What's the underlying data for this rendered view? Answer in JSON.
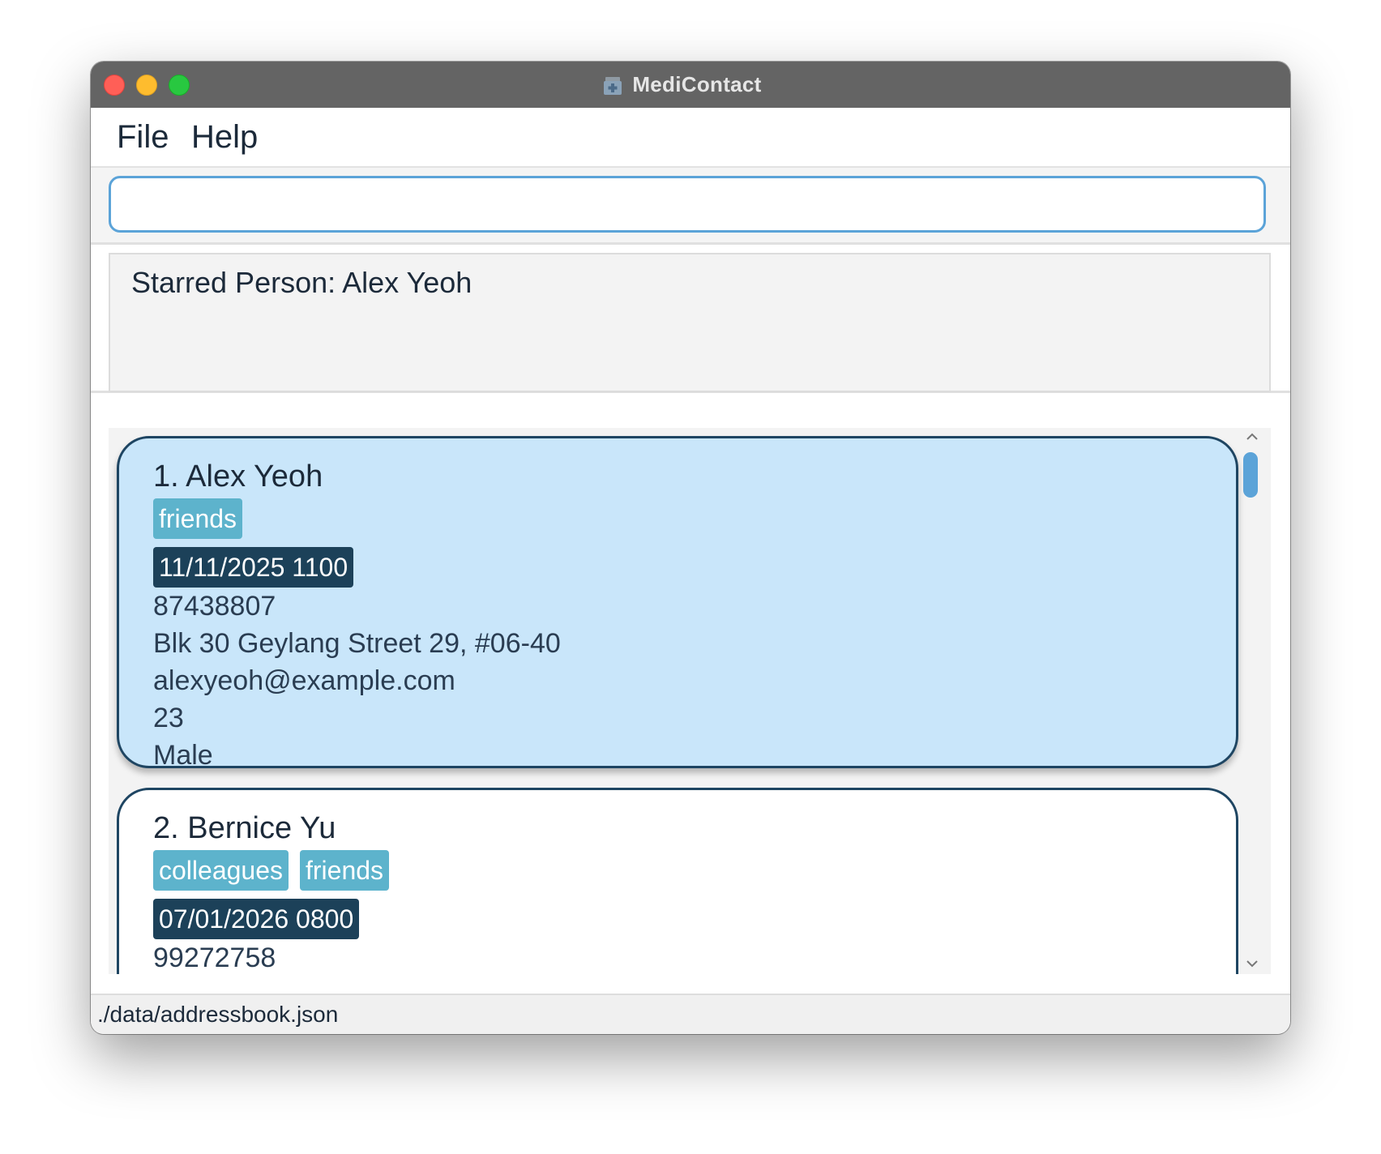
{
  "window": {
    "title": "MediContact",
    "app_icon": "medical-kit-icon"
  },
  "menu": {
    "file_label": "File",
    "help_label": "Help"
  },
  "command": {
    "value": "",
    "placeholder": ""
  },
  "result": {
    "text": "Starred Person: Alex Yeoh"
  },
  "persons": [
    {
      "name": "1. Alex Yeoh",
      "tags": [
        "friends"
      ],
      "appointment": "11/11/2025 1100",
      "phone": "87438807",
      "address": "Blk 30 Geylang Street 29, #06-40",
      "email": "alexyeoh@example.com",
      "age": "23",
      "sex": "Male",
      "selected": true
    },
    {
      "name": "2. Bernice Yu",
      "tags": [
        "colleagues",
        "friends"
      ],
      "appointment": "07/01/2026 0800",
      "phone": "99272758",
      "selected": false
    }
  ],
  "status": {
    "path": "./data/addressbook.json"
  },
  "colors": {
    "titlebar": "#646464",
    "accent": "#5ba3d8",
    "card_border": "#1e4562",
    "selected_card": "#c9e6fa",
    "tag": "#5db3cc",
    "appointment_tag": "#1c4159"
  }
}
